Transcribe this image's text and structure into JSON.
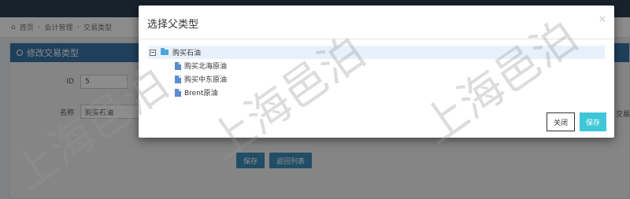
{
  "breadcrumb": {
    "items": [
      "首页",
      "会计管理",
      "交易类型"
    ],
    "sep": "›"
  },
  "panel": {
    "title": "修改交易类型"
  },
  "form": {
    "id_label": "ID",
    "id_value": "5",
    "name_label": "名称",
    "name_value": "购买石油",
    "right_fragment": "交易"
  },
  "page_buttons": {
    "save": "保存",
    "back": "返回列表"
  },
  "modal": {
    "title": "选择父类型",
    "close_glyph": "×",
    "tree": {
      "root": "购买石油",
      "children": [
        "购买北海原油",
        "购买中东原油",
        "Brent原油"
      ]
    },
    "buttons": {
      "close": "关闭",
      "save": "保存"
    }
  },
  "watermark": "上海邑泊"
}
